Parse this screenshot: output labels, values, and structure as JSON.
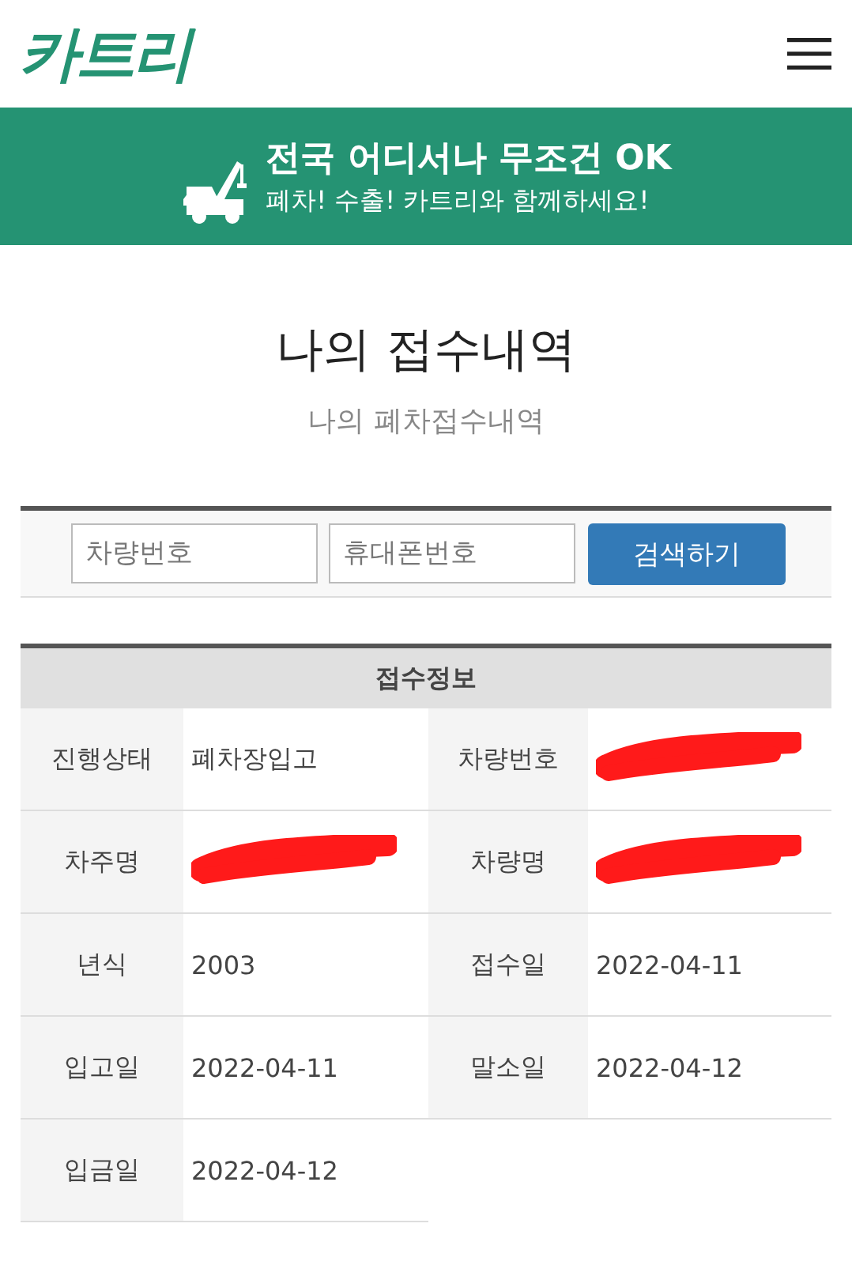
{
  "header": {
    "logo": "카트리"
  },
  "banner": {
    "headline": "전국 어디서나 무조건 OK",
    "subline": "폐차! 수출! 카트리와 함께하세요!"
  },
  "page": {
    "title": "나의 접수내역",
    "subtitle": "나의 폐차접수내역"
  },
  "search": {
    "fields": [
      {
        "placeholder": "차량번호"
      },
      {
        "placeholder": "휴대폰번호"
      }
    ],
    "button": "검색하기"
  },
  "info_table": {
    "title": "접수정보",
    "rows": [
      [
        {
          "label": "진행상태",
          "value": "폐차장입고",
          "redacted": false
        },
        {
          "label": "차량번호",
          "redacted": true
        }
      ],
      [
        {
          "label": "차주명",
          "redacted": true
        },
        {
          "label": "차량명",
          "redacted": true
        }
      ],
      [
        {
          "label": "년식",
          "value": "2003",
          "redacted": false
        },
        {
          "label": "접수일",
          "value": "2022-04-11",
          "redacted": false
        }
      ],
      [
        {
          "label": "입고일",
          "value": "2022-04-11",
          "redacted": false
        },
        {
          "label": "말소일",
          "value": "2022-04-12",
          "redacted": false
        }
      ],
      [
        {
          "label": "입금일",
          "value": "2022-04-12",
          "redacted": false
        }
      ]
    ]
  }
}
